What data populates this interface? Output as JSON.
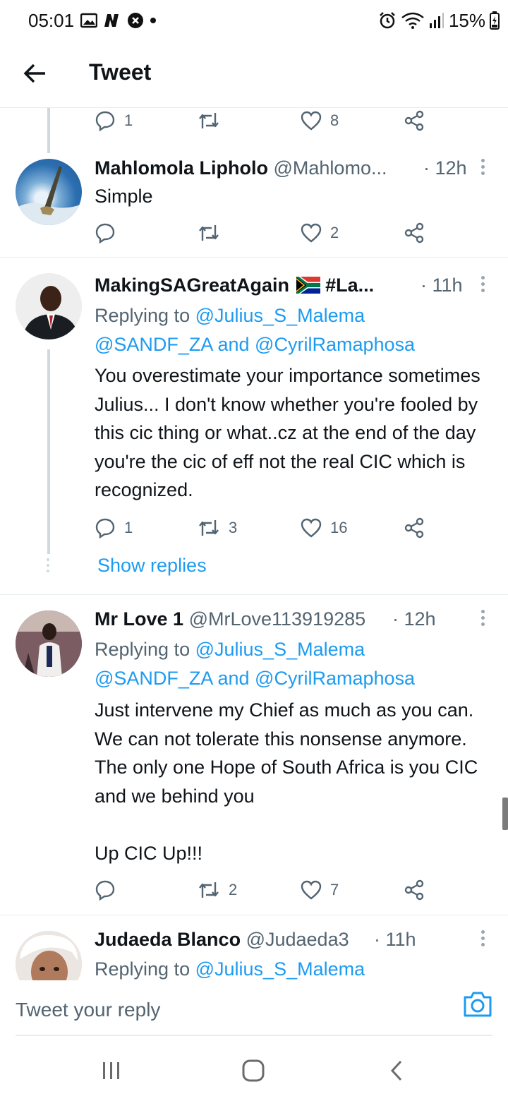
{
  "status_bar": {
    "time": "05:01",
    "battery": "15%"
  },
  "header": {
    "title": "Tweet"
  },
  "tweets": [
    {
      "stats": {
        "replies": "1",
        "retweets": "",
        "likes": "8"
      }
    },
    {
      "name": "Mahlomola Lipholo",
      "handle": "@Mahlomo...",
      "time": "· 12h",
      "text": "Simple",
      "stats": {
        "replies": "",
        "retweets": "",
        "likes": "2"
      }
    },
    {
      "name": "MakingSAGreatAgain",
      "name_suffix": "#La...",
      "time": "· 11h",
      "replying_to_label": "Replying to",
      "mention_1": "@Julius_S_Malema",
      "mention_2": "@SANDF_ZA",
      "and_word": "and",
      "mention_3": "@CyrilRamaphosa",
      "text": "You overestimate your importance sometimes Julius... I don't know whether you're fooled by this cic thing or what..cz at the end of the day you're the cic of eff not the real CIC which is recognized.",
      "stats": {
        "replies": "1",
        "retweets": "3",
        "likes": "16"
      },
      "show_replies": "Show replies"
    },
    {
      "name": "Mr Love 1",
      "handle": "@MrLove113919285",
      "time": "· 12h",
      "replying_to_label": "Replying to",
      "mention_1": "@Julius_S_Malema",
      "mention_2": "@SANDF_ZA",
      "and_word": "and",
      "mention_3": "@CyrilRamaphosa",
      "text": "Just intervene my Chief as much as you can. We can not tolerate this nonsense anymore. The only one Hope of South Africa is you CIC and we behind you\n\nUp CIC Up!!!",
      "stats": {
        "replies": "",
        "retweets": "2",
        "likes": "7"
      }
    },
    {
      "name": "Judaeda Blanco",
      "handle": "@Judaeda3",
      "time": "· 11h",
      "replying_to_label": "Replying to",
      "mention_1": "@Julius_S_Malema"
    }
  ],
  "reply_box": {
    "placeholder": "Tweet your reply"
  },
  "colors": {
    "accent": "#1d9bf0",
    "secondary_text": "#536471",
    "divider": "#e6ecf0"
  },
  "icons": [
    "back-arrow-icon",
    "reply-icon",
    "retweet-icon",
    "like-icon",
    "share-icon",
    "more-icon",
    "camera-icon",
    "recents-icon",
    "home-icon",
    "back-nav-icon"
  ]
}
